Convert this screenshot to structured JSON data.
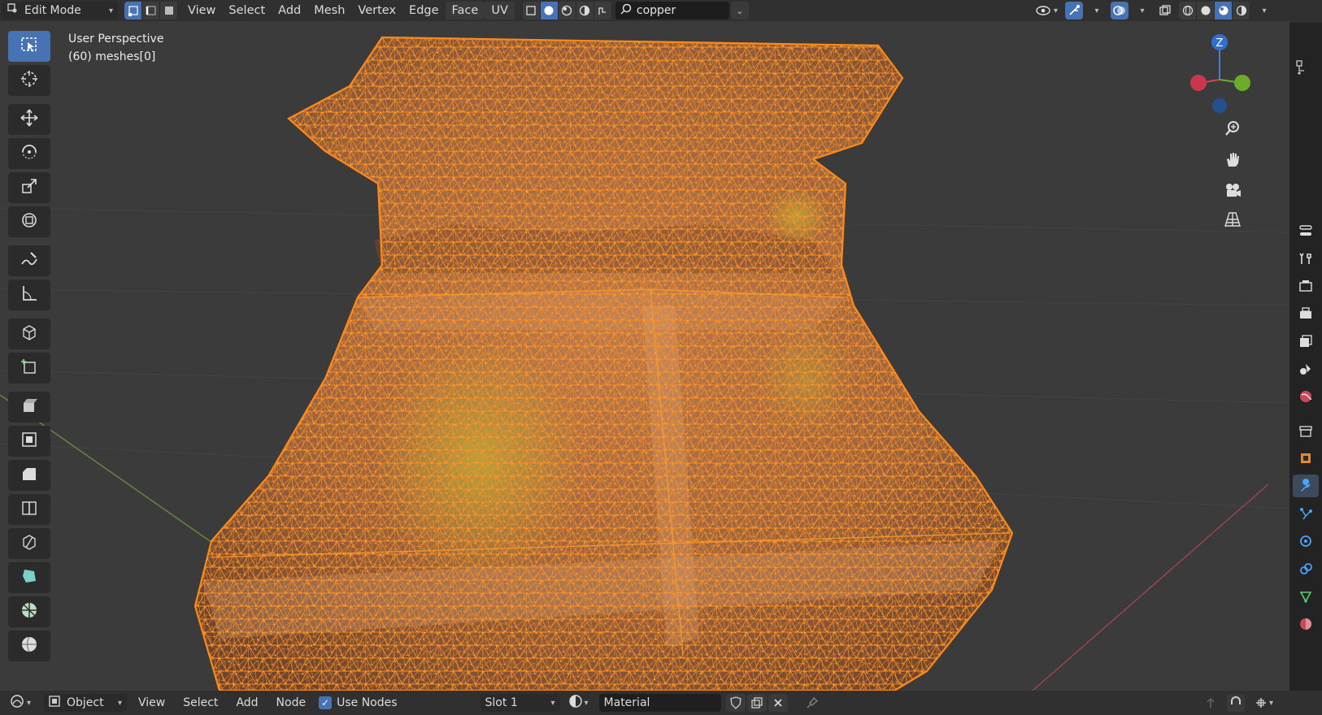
{
  "header": {
    "mode": "Edit Mode",
    "menus": [
      "View",
      "Select",
      "Add",
      "Mesh",
      "Vertex",
      "Edge",
      "Face",
      "UV"
    ],
    "search_value": "copper"
  },
  "viewport": {
    "view_name": "User Perspective",
    "object_info": "(60) meshes[0]",
    "gizmo_axis_label": "Z"
  },
  "bottom": {
    "editor_mode": "Object",
    "menus": [
      "View",
      "Select",
      "Add",
      "Node"
    ],
    "use_nodes_label": "Use Nodes",
    "slot": "Slot 1",
    "material_name": "Material"
  },
  "colors": {
    "accent": "#4772b3",
    "mesh_orange": "#ff8a1a",
    "header_bg": "#303030",
    "viewport_bg": "#3b3b3b"
  }
}
